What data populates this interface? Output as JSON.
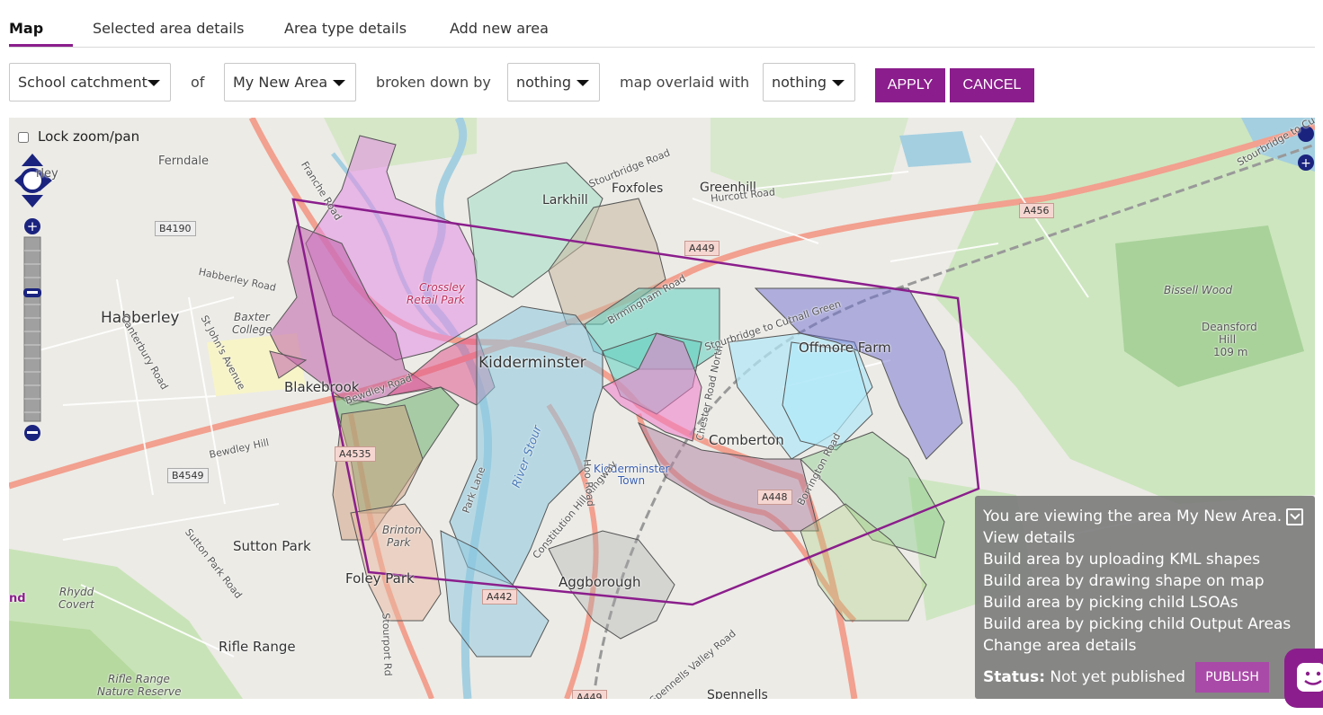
{
  "tabs": [
    {
      "label": "Map",
      "active": true
    },
    {
      "label": "Selected area details"
    },
    {
      "label": "Area type details"
    },
    {
      "label": "Add new area"
    }
  ],
  "filters": {
    "area_type": "School catchment",
    "of": "of",
    "area": "My New Area",
    "broken_down_by": "broken down by",
    "breakdown": "nothing",
    "overlaid_with": "map overlaid with",
    "overlay": "nothing",
    "apply_label": "APPLY",
    "cancel_label": "CANCEL"
  },
  "map": {
    "lock_label": "Lock zoom/pan",
    "place_labels": {
      "ferndale": "Ferndale",
      "habberley": "Habberley",
      "habberley_short": "rley",
      "baxter": "Baxter",
      "college": "College",
      "blakebrook": "Blakebrook",
      "kidderminster": "Kidderminster",
      "crossley": "Crossley",
      "retail_park": "Retail Park",
      "larkhill": "Larkhill",
      "foxfoles": "Foxfoles",
      "greenhill": "Greenhill",
      "offmore_farm": "Offmore Farm",
      "comberton": "Comberton",
      "kidderminster_town_1": "Kidderminster",
      "kidderminster_town_2": "Town",
      "aggborough": "Aggborough",
      "sutton_park": "Sutton Park",
      "foley_park": "Foley Park",
      "brinton": "Brinton",
      "park": "Park",
      "rifle_range": "Rifle Range",
      "rifle_range_nr_1": "Rifle Range",
      "rifle_range_nr_2": "Nature Reserve",
      "rhydd": "Rhydd",
      "covert": "Covert",
      "bissell_wood": "Bissell Wood",
      "deansford": "Deansford",
      "hill": "Hill",
      "height": "109 m",
      "spennells": "Spennells",
      "river_stour": "River Stour",
      "nd": "nd"
    },
    "road_labels": {
      "b4190": "B4190",
      "b4549": "B4549",
      "a4535": "A4535",
      "a456": "A456",
      "a449": "A449",
      "a448": "A448",
      "a442": "A442",
      "a449b": "A449",
      "habberley_road": "Habberley Road",
      "stourbridge_road": "Stourbridge Road",
      "hurcott_road": "Hurcott Road",
      "birmingham_road": "Birmingham Road",
      "stourbridge_cutnall": "Stourbridge to Cutnall Green",
      "bewdley_hill": "Bewdley Hill",
      "bewdley_road": "Bewdley Road",
      "franche_road": "Franche Road",
      "park_lane": "Park Lane",
      "constitution_hill": "Constitution Hill Ringway",
      "hoo_road": "Hoo Road",
      "sutton_park_road": "Sutton Park Road",
      "stourport_road": "Stourport Rd",
      "spennells_valley": "Spennells Valley Road",
      "chester_road": "Chester Road North",
      "canterbury_road": "Canterbury Road",
      "st_johns": "St John's Avenue",
      "borrington_road": "Borrington Road",
      "stourbridge_cut": "Stourbridge to Cu"
    }
  },
  "info_panel": {
    "viewing_text": "You are viewing the area My New Area.",
    "links": [
      "View details",
      "Build area by uploading KML shapes",
      "Build area by drawing shape on map",
      "Build area by picking child LSOAs",
      "Build area by picking child Output Areas",
      "Change area details"
    ],
    "status_label": "Status:",
    "status_value": "Not yet published",
    "publish_label": "PUBLISH"
  },
  "colors": {
    "accent": "#8b1e8c",
    "polygon_outline": "#8b1e8c"
  }
}
